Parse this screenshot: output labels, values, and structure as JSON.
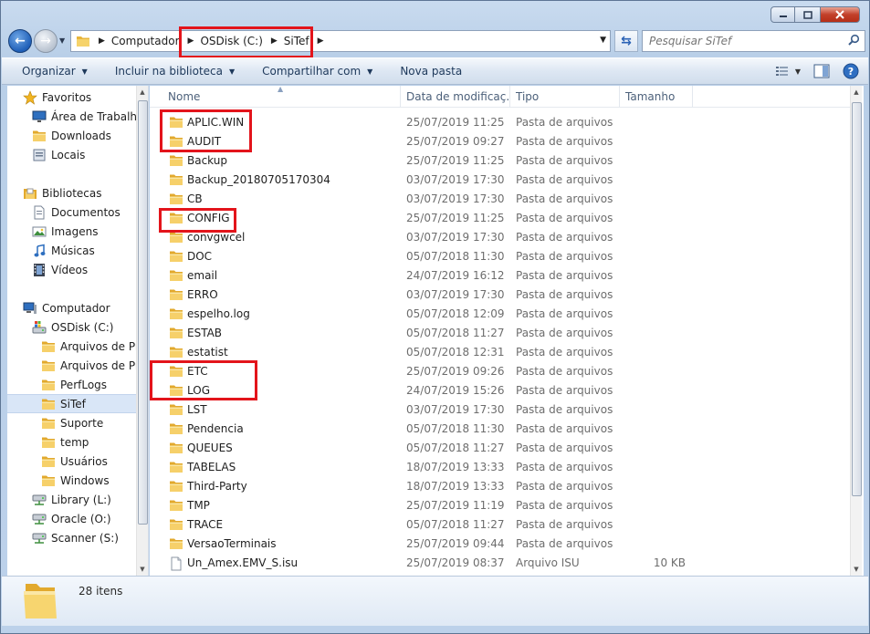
{
  "window": {
    "caption_buttons": [
      "minimize",
      "maximize",
      "close"
    ]
  },
  "address_bar": {
    "breadcrumbs": [
      "Computador",
      "OSDisk (C:)",
      "SiTef"
    ],
    "search_placeholder": "Pesquisar SiTef"
  },
  "toolbar": {
    "organize": "Organizar",
    "include_library": "Incluir na biblioteca",
    "share": "Compartilhar com",
    "new_folder": "Nova pasta"
  },
  "nav": {
    "items": [
      {
        "label": "Favoritos",
        "icon": "star-icon"
      },
      {
        "label": "Área de Trabalho",
        "icon": "desktop-icon"
      },
      {
        "label": "Downloads",
        "icon": "downloads-folder-icon"
      },
      {
        "label": "Locais",
        "icon": "recent-places-icon"
      },
      {
        "label": "Bibliotecas",
        "icon": "libraries-icon"
      },
      {
        "label": "Documentos",
        "icon": "documents-icon"
      },
      {
        "label": "Imagens",
        "icon": "pictures-icon"
      },
      {
        "label": "Músicas",
        "icon": "music-icon"
      },
      {
        "label": "Vídeos",
        "icon": "videos-icon"
      },
      {
        "label": "Computador",
        "icon": "computer-icon"
      },
      {
        "label": "OSDisk (C:)",
        "icon": "drive-icon"
      },
      {
        "label": "Arquivos de Pro",
        "icon": "folder-icon"
      },
      {
        "label": "Arquivos de Pro",
        "icon": "folder-icon"
      },
      {
        "label": "PerfLogs",
        "icon": "folder-icon"
      },
      {
        "label": "SiTef",
        "icon": "folder-icon"
      },
      {
        "label": "Suporte",
        "icon": "folder-icon"
      },
      {
        "label": "temp",
        "icon": "folder-icon"
      },
      {
        "label": "Usuários",
        "icon": "folder-icon"
      },
      {
        "label": "Windows",
        "icon": "folder-icon"
      },
      {
        "label": "Library (L:)",
        "icon": "network-drive-icon"
      },
      {
        "label": "Oracle (O:)",
        "icon": "network-drive-icon"
      },
      {
        "label": "Scanner (S:)",
        "icon": "network-drive-icon"
      }
    ]
  },
  "columns": {
    "name": "Nome",
    "date": "Data de modificaç...",
    "type": "Tipo",
    "size": "Tamanho"
  },
  "files": [
    {
      "name": "APLIC.WIN",
      "date": "25/07/2019 11:25",
      "type": "Pasta de arquivos",
      "size": "",
      "kind": "folder"
    },
    {
      "name": "AUDIT",
      "date": "25/07/2019 09:27",
      "type": "Pasta de arquivos",
      "size": "",
      "kind": "folder"
    },
    {
      "name": "Backup",
      "date": "25/07/2019 11:25",
      "type": "Pasta de arquivos",
      "size": "",
      "kind": "folder"
    },
    {
      "name": "Backup_20180705170304",
      "date": "03/07/2019 17:30",
      "type": "Pasta de arquivos",
      "size": "",
      "kind": "folder"
    },
    {
      "name": "CB",
      "date": "03/07/2019 17:30",
      "type": "Pasta de arquivos",
      "size": "",
      "kind": "folder"
    },
    {
      "name": "CONFIG",
      "date": "25/07/2019 11:25",
      "type": "Pasta de arquivos",
      "size": "",
      "kind": "folder"
    },
    {
      "name": "convgwcel",
      "date": "03/07/2019 17:30",
      "type": "Pasta de arquivos",
      "size": "",
      "kind": "folder"
    },
    {
      "name": "DOC",
      "date": "05/07/2018 11:30",
      "type": "Pasta de arquivos",
      "size": "",
      "kind": "folder"
    },
    {
      "name": "email",
      "date": "24/07/2019 16:12",
      "type": "Pasta de arquivos",
      "size": "",
      "kind": "folder"
    },
    {
      "name": "ERRO",
      "date": "03/07/2019 17:30",
      "type": "Pasta de arquivos",
      "size": "",
      "kind": "folder"
    },
    {
      "name": "espelho.log",
      "date": "05/07/2018 12:09",
      "type": "Pasta de arquivos",
      "size": "",
      "kind": "folder"
    },
    {
      "name": "ESTAB",
      "date": "05/07/2018 11:27",
      "type": "Pasta de arquivos",
      "size": "",
      "kind": "folder"
    },
    {
      "name": "estatist",
      "date": "05/07/2018 12:31",
      "type": "Pasta de arquivos",
      "size": "",
      "kind": "folder"
    },
    {
      "name": "ETC",
      "date": "25/07/2019 09:26",
      "type": "Pasta de arquivos",
      "size": "",
      "kind": "folder"
    },
    {
      "name": "LOG",
      "date": "24/07/2019 15:26",
      "type": "Pasta de arquivos",
      "size": "",
      "kind": "folder"
    },
    {
      "name": "LST",
      "date": "03/07/2019 17:30",
      "type": "Pasta de arquivos",
      "size": "",
      "kind": "folder"
    },
    {
      "name": "Pendencia",
      "date": "05/07/2018 11:30",
      "type": "Pasta de arquivos",
      "size": "",
      "kind": "folder"
    },
    {
      "name": "QUEUES",
      "date": "05/07/2018 11:27",
      "type": "Pasta de arquivos",
      "size": "",
      "kind": "folder"
    },
    {
      "name": "TABELAS",
      "date": "18/07/2019 13:33",
      "type": "Pasta de arquivos",
      "size": "",
      "kind": "folder"
    },
    {
      "name": "Third-Party",
      "date": "18/07/2019 13:33",
      "type": "Pasta de arquivos",
      "size": "",
      "kind": "folder"
    },
    {
      "name": "TMP",
      "date": "25/07/2019 11:19",
      "type": "Pasta de arquivos",
      "size": "",
      "kind": "folder"
    },
    {
      "name": "TRACE",
      "date": "05/07/2018 11:27",
      "type": "Pasta de arquivos",
      "size": "",
      "kind": "folder"
    },
    {
      "name": "VersaoTerminais",
      "date": "25/07/2019 09:44",
      "type": "Pasta de arquivos",
      "size": "",
      "kind": "folder"
    },
    {
      "name": "Un_Amex.EMV_S.isu",
      "date": "25/07/2019 08:37",
      "type": "Arquivo ISU",
      "size": "10 KB",
      "kind": "file"
    }
  ],
  "details": {
    "item_count": "28 itens"
  },
  "colors": {
    "highlight": "#e3141b",
    "folder": "#f4cc52",
    "selection": "#d9e6f7"
  }
}
